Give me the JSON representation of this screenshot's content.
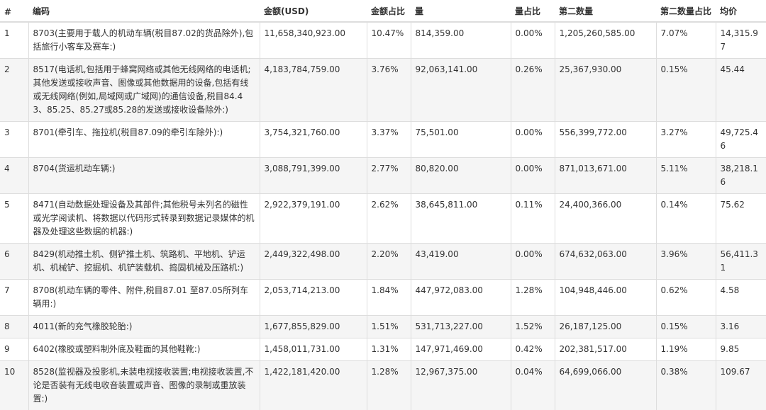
{
  "table": {
    "headers": [
      "#",
      "编码",
      "金额(USD)",
      "金额占比",
      "量",
      "量占比",
      "第二数量",
      "第二数量占比",
      "均价"
    ],
    "rows": [
      [
        "1",
        "8703(主要用于载人的机动车辆(税目87.02的货品除外),包括旅行小客车及赛车:)",
        "11,658,340,923.00",
        "10.47%",
        "814,359.00",
        "0.00%",
        "1,205,260,585.00",
        "7.07%",
        "14,315.97"
      ],
      [
        "2",
        "8517(电话机,包括用于蜂窝网络或其他无线网络的电话机;其他发送或接收声音、图像或其他数据用的设备,包括有线或无线网络(例如,局域网或广域网)的通信设备,税目84.43、85.25、85.27或85.28的发送或接收设备除外:)",
        "4,183,784,759.00",
        "3.76%",
        "92,063,141.00",
        "0.26%",
        "25,367,930.00",
        "0.15%",
        "45.44"
      ],
      [
        "3",
        "8701(牵引车、拖拉机(税目87.09的牵引车除外):)",
        "3,754,321,760.00",
        "3.37%",
        "75,501.00",
        "0.00%",
        "556,399,772.00",
        "3.27%",
        "49,725.46"
      ],
      [
        "4",
        "8704(货运机动车辆:)",
        "3,088,791,399.00",
        "2.77%",
        "80,820.00",
        "0.00%",
        "871,013,671.00",
        "5.11%",
        "38,218.16"
      ],
      [
        "5",
        "8471(自动数据处理设备及其部件;其他税号未列名的磁性或光学阅读机、将数据以代码形式转录到数据记录媒体的机器及处理这些数据的机器:)",
        "2,922,379,191.00",
        "2.62%",
        "38,645,811.00",
        "0.11%",
        "24,400,366.00",
        "0.14%",
        "75.62"
      ],
      [
        "6",
        "8429(机动推土机、侧铲推土机、筑路机、平地机、铲运机、机械铲、挖掘机、机铲装载机、捣固机械及压路机:)",
        "2,449,322,498.00",
        "2.20%",
        "43,419.00",
        "0.00%",
        "674,632,063.00",
        "3.96%",
        "56,411.31"
      ],
      [
        "7",
        "8708(机动车辆的零件、附件,税目87.01 至87.05所列车辆用:)",
        "2,053,714,213.00",
        "1.84%",
        "447,972,083.00",
        "1.28%",
        "104,948,446.00",
        "0.62%",
        "4.58"
      ],
      [
        "8",
        "4011(新的充气橡胶轮胎:)",
        "1,677,855,829.00",
        "1.51%",
        "531,713,227.00",
        "1.52%",
        "26,187,125.00",
        "0.15%",
        "3.16"
      ],
      [
        "9",
        "6402(橡胶或塑料制外底及鞋面的其他鞋靴:)",
        "1,458,011,731.00",
        "1.31%",
        "147,971,469.00",
        "0.42%",
        "202,381,517.00",
        "1.19%",
        "9.85"
      ],
      [
        "10",
        "8528(监视器及投影机,未装电视接收装置;电视接收装置,不论是否装有无线电收音装置或声音、图像的录制或重放装置:)",
        "1,422,181,420.00",
        "1.28%",
        "12,967,375.00",
        "0.04%",
        "64,699,066.00",
        "0.38%",
        "109.67"
      ]
    ]
  }
}
